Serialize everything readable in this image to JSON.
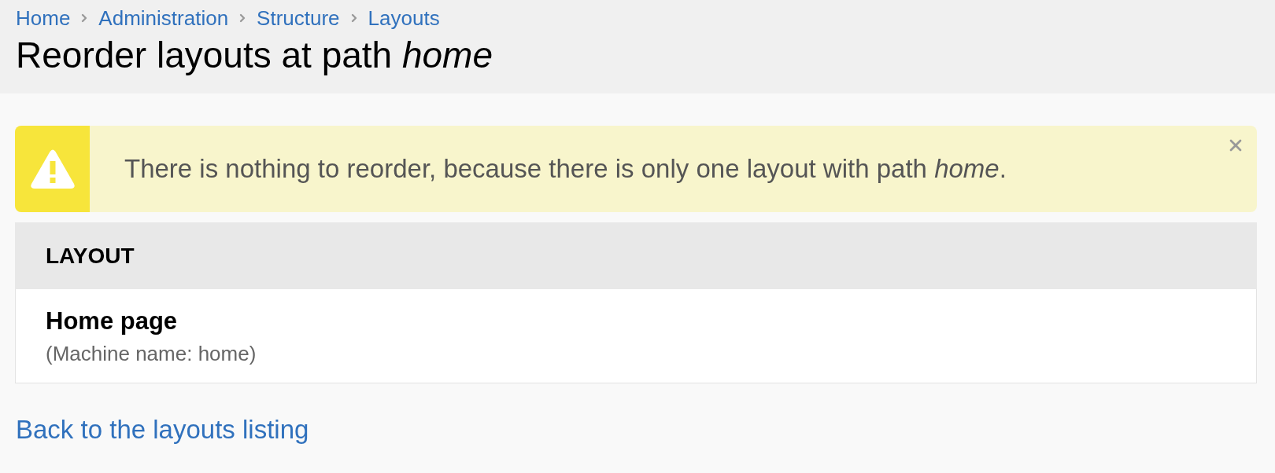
{
  "breadcrumb": [
    "Home",
    "Administration",
    "Structure",
    "Layouts"
  ],
  "page_title": "Reorder layouts at path *home*",
  "alert": {
    "kind": "warning",
    "message": "There is nothing to reorder, because there is only one layout with path *home*.",
    "dismissible": true
  },
  "table": {
    "columns": [
      "LAYOUT"
    ],
    "rows": [
      {
        "name": "Home page",
        "machine_name": "(Machine name: home)"
      }
    ]
  },
  "back_link": "Back to the layouts listing"
}
